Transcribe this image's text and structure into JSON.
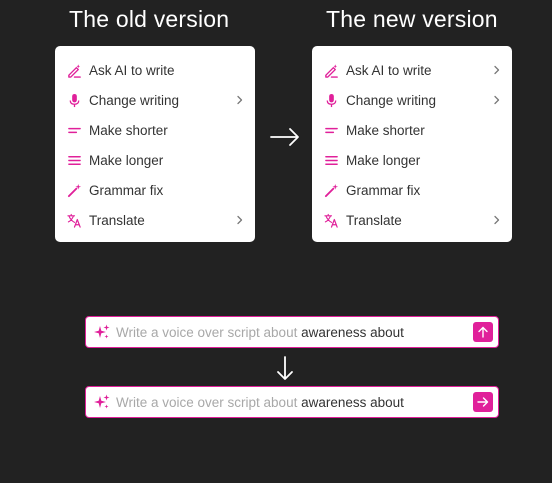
{
  "headings": {
    "old": "The old version",
    "new": "The new version"
  },
  "colors": {
    "background": "#222222",
    "accent": "#e0209a",
    "menu_bg": "#ffffff",
    "menu_text": "#333333",
    "placeholder": "#a8a8a8"
  },
  "old_menu": {
    "items": [
      {
        "label": "Ask AI to write",
        "icon": "pen-sparkle-icon",
        "submenu": false
      },
      {
        "label": "Change writing",
        "icon": "microphone-icon",
        "submenu": true
      },
      {
        "label": "Make shorter",
        "icon": "short-text-icon",
        "submenu": false
      },
      {
        "label": "Make longer",
        "icon": "long-text-icon",
        "submenu": false
      },
      {
        "label": "Grammar fix",
        "icon": "magic-wand-icon",
        "submenu": false
      },
      {
        "label": "Translate",
        "icon": "translate-icon",
        "submenu": true
      }
    ]
  },
  "new_menu": {
    "items": [
      {
        "label": "Ask AI to write",
        "icon": "pen-sparkle-icon",
        "submenu": true
      },
      {
        "label": "Change writing",
        "icon": "microphone-icon",
        "submenu": true
      },
      {
        "label": "Make shorter",
        "icon": "short-text-icon",
        "submenu": false
      },
      {
        "label": "Make longer",
        "icon": "long-text-icon",
        "submenu": false
      },
      {
        "label": "Grammar fix",
        "icon": "magic-wand-icon",
        "submenu": false
      },
      {
        "label": "Translate",
        "icon": "translate-icon",
        "submenu": true
      }
    ]
  },
  "prompt_old": {
    "placeholder": "Write a voice over script about ",
    "value": "awareness about",
    "send_icon": "arrow-up-icon"
  },
  "prompt_new": {
    "placeholder": "Write a voice over script about ",
    "value": "awareness about",
    "send_icon": "arrow-right-icon"
  },
  "transition_icons": {
    "horizontal": "arrow-right-icon",
    "vertical": "arrow-down-icon"
  }
}
